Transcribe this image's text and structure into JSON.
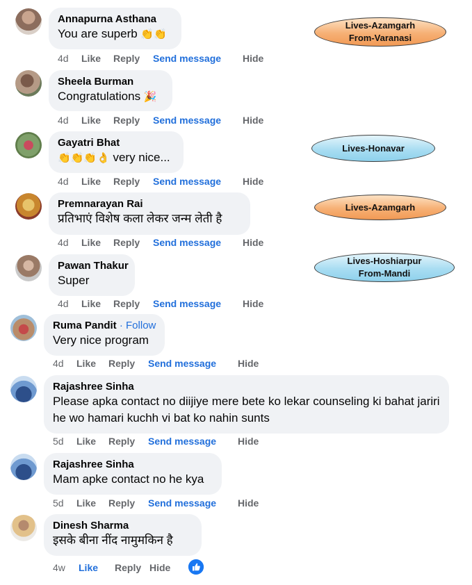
{
  "actions": {
    "like": "Like",
    "reply": "Reply",
    "send_message": "Send message",
    "hide": "Hide"
  },
  "comments": [
    {
      "name": "Annapurna Asthana",
      "text": "You are superb",
      "emoji": "👏👏",
      "time": "4d"
    },
    {
      "name": "Sheela Burman",
      "text": "Congratulations",
      "emoji": "🎉",
      "time": "4d"
    },
    {
      "name": "Gayatri Bhat",
      "text": "very nice...",
      "emoji": "👏👏👏👌",
      "time": "4d"
    },
    {
      "name": "Premnarayan Rai",
      "text": "प्रतिभाएं विशेष कला लेकर जन्म लेती है",
      "time": "4d"
    },
    {
      "name": "Pawan Thakur",
      "text": "Super",
      "time": "4d"
    },
    {
      "name": "Ruma Pandit",
      "follow": "· Follow",
      "text": "Very nice program",
      "time": "4d"
    },
    {
      "name": "Rajashree Sinha",
      "text": "Please apka contact no diijiye mere bete ko lekar counseling ki bahat jariri he wo hamari kuchh vi bat ko nahin sunts",
      "time": "5d"
    },
    {
      "name": "Rajashree Sinha",
      "text": "Mam apke contact no he kya",
      "time": "5d"
    },
    {
      "name": "Dinesh Sharma",
      "text": "इसके बीना नींद नामुमकिन है",
      "time": "4w",
      "like_count_icon": "thumbs-up-icon"
    }
  ],
  "tags": [
    {
      "line1": "Lives-Azamgarh",
      "line2": "From-Varanasi",
      "color": "orange"
    },
    {
      "line1": "Lives-Honavar",
      "line2": "",
      "color": "blue"
    },
    {
      "line1": "Lives-Azamgarh",
      "line2": "",
      "color": "orange"
    },
    {
      "line1": "Lives-Hoshiarpur",
      "line2": "From-Mandi",
      "color": "blue"
    }
  ],
  "colors": {
    "link": "#216fdb",
    "bubble": "#f0f2f5",
    "meta": "#65676b",
    "tag_orange": "#f6b075",
    "tag_blue": "#a9ddf2"
  }
}
